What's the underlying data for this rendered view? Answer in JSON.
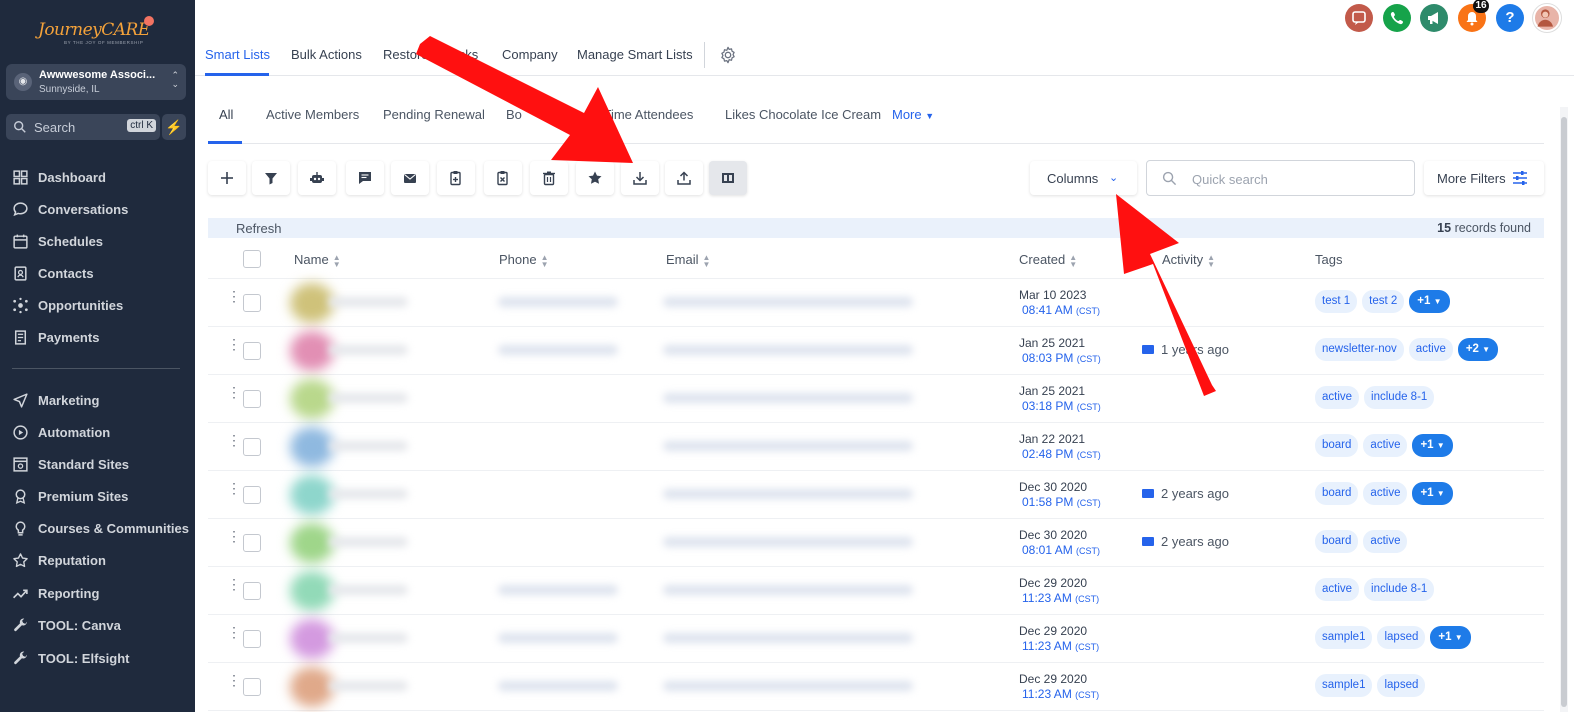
{
  "sidebar": {
    "logo_text": "JourneyCARE",
    "logo_tagline": "BY THE JOY OF MEMBERSHIP",
    "account_name": "Awwwesome Associ...",
    "account_location": "Sunnyside, IL",
    "search_placeholder": "Search",
    "search_shortcut": "ctrl K",
    "nav_primary": [
      "Dashboard",
      "Conversations",
      "Schedules",
      "Contacts",
      "Opportunities",
      "Payments"
    ],
    "nav_secondary": [
      "Marketing",
      "Automation",
      "Standard Sites",
      "Premium Sites",
      "Courses & Communities",
      "Reputation",
      "Reporting",
      "TOOL: Canva",
      "TOOL: Elfsight"
    ]
  },
  "topbar": {
    "tabs": [
      "Smart Lists",
      "Bulk Actions",
      "Restore",
      "Tasks",
      "Company",
      "Manage Smart Lists"
    ],
    "active_tab": "Smart Lists",
    "notification_count": "16",
    "help_label": "?"
  },
  "smart_lists": {
    "tabs": [
      "All",
      "Active Members",
      "Pending Renewal",
      "Bo",
      "st Time Attendees",
      "Likes Chocolate Ice Cream"
    ],
    "more_label": "More"
  },
  "toolbar": {
    "columns_label": "Columns",
    "quick_search_placeholder": "Quick search",
    "more_filters_label": "More Filters"
  },
  "table": {
    "refresh_label": "Refresh",
    "records_count": "15",
    "records_suffix": "records found",
    "columns": [
      "Name",
      "Phone",
      "Email",
      "Created",
      "Activity",
      "Tags"
    ],
    "rows": [
      {
        "date": "Mar 10 2023",
        "time": "08:41 AM",
        "tz": "(CST)",
        "activity": "",
        "tags": [
          "test 1",
          "test 2"
        ],
        "more": "+1",
        "avatar_color": "#cfc27a"
      },
      {
        "date": "Jan 25 2021",
        "time": "08:03 PM",
        "tz": "(CST)",
        "activity": "1 years ago",
        "tags": [
          "newsletter-nov",
          "active"
        ],
        "more": "+2",
        "avatar_color": "#e28fb4"
      },
      {
        "date": "Jan 25 2021",
        "time": "03:18 PM",
        "tz": "(CST)",
        "activity": "",
        "tags": [
          "active",
          "include 8-1"
        ],
        "more": "",
        "avatar_color": "#b9d88c"
      },
      {
        "date": "Jan 22 2021",
        "time": "02:48 PM",
        "tz": "(CST)",
        "activity": "",
        "tags": [
          "board",
          "active"
        ],
        "more": "+1",
        "avatar_color": "#8fb9e0"
      },
      {
        "date": "Dec 30 2020",
        "time": "01:58 PM",
        "tz": "(CST)",
        "activity": "2 years ago",
        "tags": [
          "board",
          "active"
        ],
        "more": "+1",
        "avatar_color": "#8ed6cc"
      },
      {
        "date": "Dec 30 2020",
        "time": "08:01 AM",
        "tz": "(CST)",
        "activity": "2 years ago",
        "tags": [
          "board",
          "active"
        ],
        "more": "",
        "avatar_color": "#9fd68a"
      },
      {
        "date": "Dec 29 2020",
        "time": "11:23 AM",
        "tz": "(CST)",
        "activity": "",
        "tags": [
          "active",
          "include 8-1"
        ],
        "more": "",
        "avatar_color": "#92dab8"
      },
      {
        "date": "Dec 29 2020",
        "time": "11:23 AM",
        "tz": "(CST)",
        "activity": "",
        "tags": [
          "sample1",
          "lapsed"
        ],
        "more": "+1",
        "avatar_color": "#d49ae0"
      },
      {
        "date": "Dec 29 2020",
        "time": "11:23 AM",
        "tz": "(CST)",
        "activity": "",
        "tags": [
          "sample1",
          "lapsed"
        ],
        "more": "",
        "avatar_color": "#e0a98a"
      }
    ]
  },
  "colors": {
    "sidebar_bg": "#1f2a3d",
    "accent": "#2563eb",
    "annotation_arrow": "#ff1010"
  }
}
